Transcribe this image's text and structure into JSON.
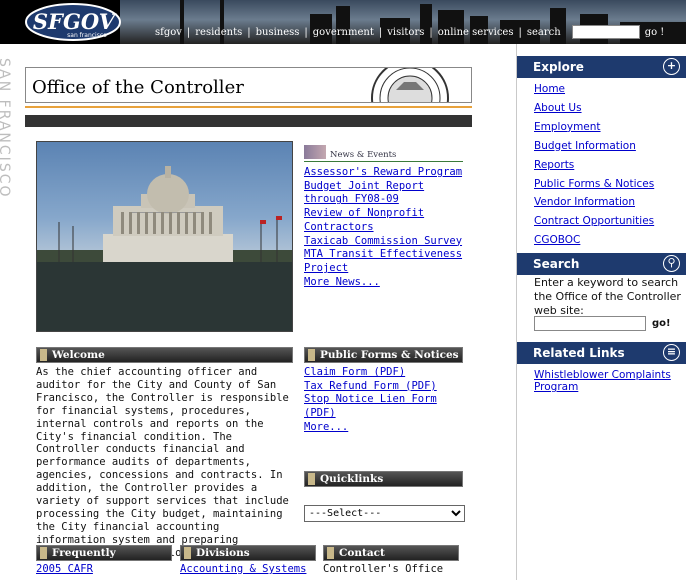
{
  "topbar": {
    "logo_main": "SFGOV",
    "logo_sub": "san francisco",
    "nav_items": [
      "sfgov",
      "residents",
      "business",
      "government",
      "visitors",
      "online services",
      "search"
    ],
    "search_placeholder": "",
    "go_label": "go !"
  },
  "left_strip": {
    "text": "SAN FRANCISCO"
  },
  "header": {
    "title": "Office of the Controller"
  },
  "news": {
    "heading": "News & Events",
    "links": [
      "Assessor's Reward Program",
      "Budget Joint Report through FY08-09",
      "Review of Nonprofit Contractors",
      "Taxicab Commission Survey",
      "MTA Transit Effectiveness Project",
      "More News..."
    ]
  },
  "welcome": {
    "heading": "Welcome",
    "text": "As the chief accounting officer and auditor for the City and County of San Francisco, the Controller is responsible for financial systems, procedures, internal controls and reports on the City's financial condition. The Controller conducts financial and performance audits of departments, agencies, concessions and contracts. In addition, the Controller provides a variety of support services that include processing the City budget, maintaining the City financial accounting information system and preparing paychecks for all employees."
  },
  "public_forms": {
    "heading": "Public Forms & Notices",
    "links": [
      "Claim Form (PDF)",
      "Tax Refund Form (PDF)",
      "Stop Notice Lien Form (PDF)",
      "More..."
    ]
  },
  "quicklinks": {
    "heading": "Quicklinks",
    "selected": "---Select---"
  },
  "frequently_requested": {
    "heading": "Frequently Requested",
    "links": [
      "2005 CAFR"
    ]
  },
  "divisions": {
    "heading": "Divisions",
    "links": [
      "Accounting & Systems"
    ]
  },
  "contact": {
    "heading": "Contact",
    "lines": [
      "Controller's Office"
    ]
  },
  "explore": {
    "heading": "Explore",
    "links": [
      "Home",
      "About Us",
      "Employment",
      "Budget Information",
      "Reports",
      "Public Forms & Notices",
      "Vendor Information",
      "Contract Opportunities",
      "CGOBOC"
    ]
  },
  "search_panel": {
    "heading": "Search",
    "text": "Enter a keyword to search the Office of the Controller web site:",
    "go_label": "go!"
  },
  "related_links": {
    "heading": "Related Links",
    "links": [
      "Whistleblower Complaints Program"
    ]
  },
  "colors": {
    "nav_blue": "#1e3a6e",
    "link": "#0000cc",
    "accent_orange": "#e8a23c"
  }
}
